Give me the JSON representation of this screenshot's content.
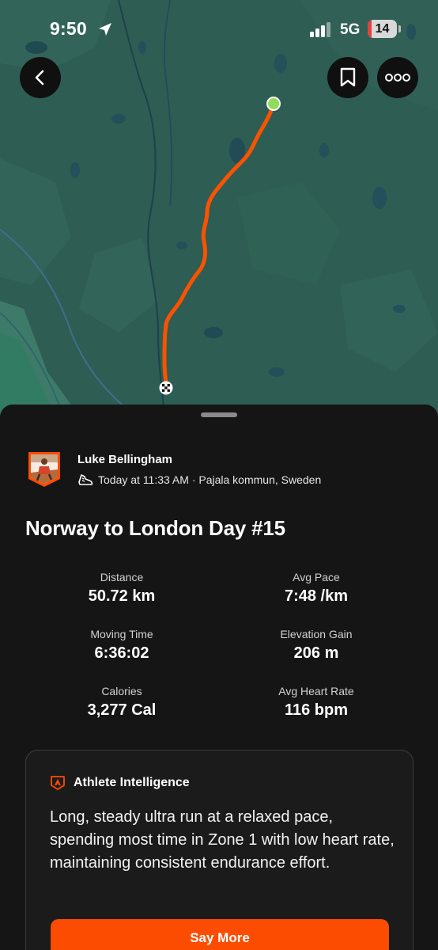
{
  "status_bar": {
    "time": "9:50",
    "network": "5G",
    "battery_level": "14",
    "battery_fraction": 0.14
  },
  "map": {
    "route_color": "#fc5200",
    "start_marker_color": "#8fdc5a",
    "icons": {
      "back": "chevron-left-icon",
      "save": "bookmark-icon",
      "more": "more-dots-icon",
      "finish": "checkered-flag-icon"
    }
  },
  "activity": {
    "athlete_name": "Luke Bellingham",
    "activity_icon": "running-shoe-icon",
    "meta": "Today at 11:33 AM · Pajala kommun, Sweden",
    "title": "Norway to London Day #15",
    "stats": [
      {
        "label": "Distance",
        "value": "50.72 km"
      },
      {
        "label": "Avg Pace",
        "value": "7:48 /km"
      },
      {
        "label": "Moving Time",
        "value": "6:36:02"
      },
      {
        "label": "Elevation Gain",
        "value": "206 m"
      },
      {
        "label": "Calories",
        "value": "3,277 Cal"
      },
      {
        "label": "Avg Heart Rate",
        "value": "116 bpm"
      }
    ]
  },
  "athlete_intelligence": {
    "title": "Athlete Intelligence",
    "summary": "Long, steady ultra run at a relaxed pace, spending most time in Zone 1 with low heart rate, maintaining consistent endurance effort.",
    "button_label": "Say More"
  },
  "colors": {
    "accent": "#fc4c02",
    "sheet_background": "#151515",
    "map_base": "#2b5b52"
  }
}
